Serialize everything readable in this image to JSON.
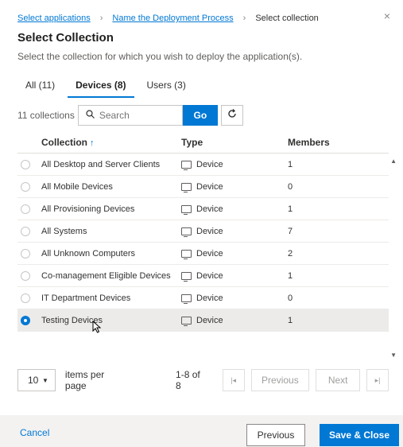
{
  "breadcrumb": {
    "items": [
      "Select applications",
      "Name the Deployment Process"
    ],
    "current": "Select collection"
  },
  "close_glyph": "×",
  "header": {
    "title": "Select Collection",
    "subtitle": "Select the collection for which you wish to deploy the application(s)."
  },
  "tabs": [
    {
      "label": "All (11)",
      "active": false
    },
    {
      "label": "Devices (8)",
      "active": true
    },
    {
      "label": "Users (3)",
      "active": false
    }
  ],
  "toolbar": {
    "count": "11 collections",
    "search_placeholder": "Search",
    "search_value": "",
    "go_label": "Go"
  },
  "grid": {
    "columns": [
      "Collection",
      "Type",
      "Members"
    ],
    "sort_indicator": "↑",
    "rows": [
      {
        "name": "All Desktop and Server Clients",
        "type": "Device",
        "members": "1",
        "selected": false
      },
      {
        "name": "All Mobile Devices",
        "type": "Device",
        "members": "0",
        "selected": false
      },
      {
        "name": "All Provisioning Devices",
        "type": "Device",
        "members": "1",
        "selected": false
      },
      {
        "name": "All Systems",
        "type": "Device",
        "members": "7",
        "selected": false
      },
      {
        "name": "All Unknown Computers",
        "type": "Device",
        "members": "2",
        "selected": false
      },
      {
        "name": "Co-management Eligible Devices",
        "type": "Device",
        "members": "1",
        "selected": false
      },
      {
        "name": "IT Department Devices",
        "type": "Device",
        "members": "0",
        "selected": false
      },
      {
        "name": "Testing Devices",
        "type": "Device",
        "members": "1",
        "selected": true
      }
    ]
  },
  "pager": {
    "page_size": "10",
    "items_per_page": "items per page",
    "range": "1-8 of 8",
    "first_glyph": "|◂",
    "previous": "Previous",
    "next": "Next",
    "last_glyph": "▸|"
  },
  "footer": {
    "cancel": "Cancel",
    "previous": "Previous",
    "save_close": "Save & Close"
  },
  "colors": {
    "accent": "#0078d4",
    "selected_row": "#edebe9",
    "footer_bg": "#f3f2f1"
  }
}
